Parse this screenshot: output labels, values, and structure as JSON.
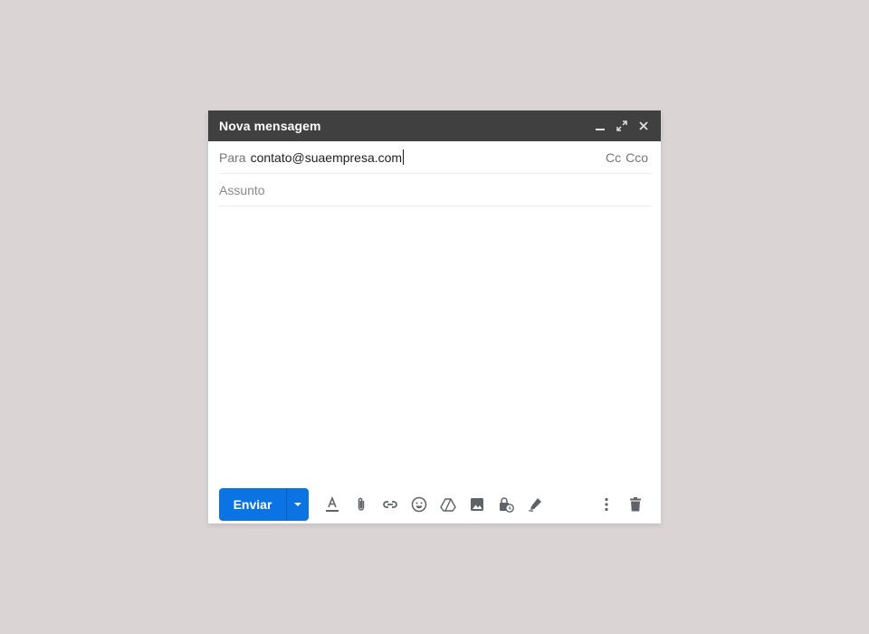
{
  "compose": {
    "title": "Nova mensagem",
    "window_controls": [
      "minimize-icon",
      "expand-icon",
      "close-icon"
    ]
  },
  "to_field": {
    "label": "Para",
    "value": "contato@suaempresa.com",
    "cc_label": "Cc",
    "bcc_label": "Cco"
  },
  "subject_field": {
    "placeholder": "Assunto",
    "value": ""
  },
  "toolbar": {
    "send_label": "Enviar",
    "accent_color": "#0b74e5",
    "icons": [
      "text-format-icon",
      "attach-icon",
      "link-icon",
      "emoji-icon",
      "drive-icon",
      "image-icon",
      "confidential-icon",
      "signature-icon",
      "more-options-icon",
      "trash-icon"
    ]
  }
}
